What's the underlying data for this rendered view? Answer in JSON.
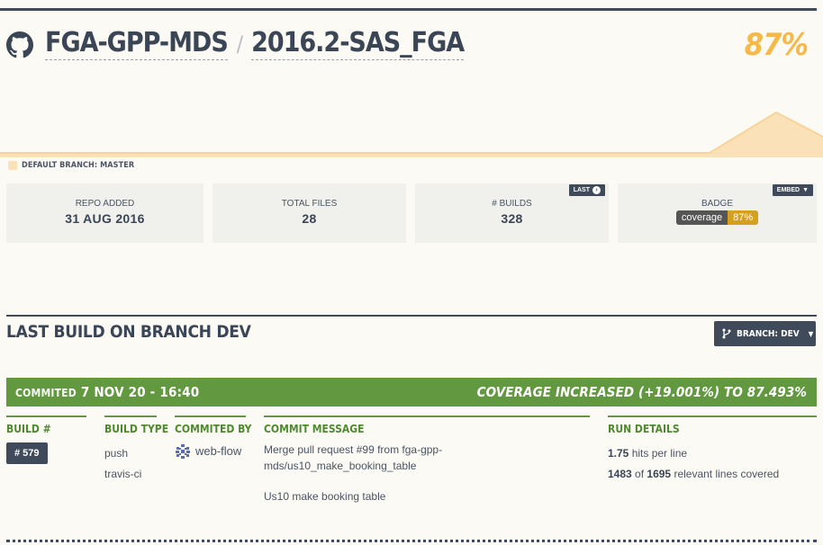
{
  "header": {
    "owner": "FGA-GPP-MDS",
    "separator": "/",
    "repo": "2016.2-SAS_FGA",
    "coverage": "87%"
  },
  "default_branch": "DEFAULT BRANCH: MASTER",
  "stats": [
    {
      "label": "REPO ADDED",
      "value": "31 AUG 2016"
    },
    {
      "label": "TOTAL FILES",
      "value": "28"
    },
    {
      "label": "# BUILDS",
      "value": "328",
      "tag": "LAST"
    },
    {
      "label": "BADGE",
      "tag": "EMBED",
      "badge_left": "coverage",
      "badge_right": "87%"
    }
  ],
  "section": {
    "title": "LAST BUILD ON BRANCH DEV",
    "branch_button": "BRANCH: DEV"
  },
  "build_bar": {
    "commited_label": "COMMITED",
    "commited_date": "7 NOV 20 - 16:40",
    "coverage_change": "COVERAGE INCREASED (+19.001%) TO 87.493%"
  },
  "columns": {
    "build": "BUILD #",
    "build_type": "BUILD TYPE",
    "commited_by": "COMMITED BY",
    "commit_message": "COMMIT MESSAGE",
    "run_details": "RUN DETAILS"
  },
  "build": {
    "number": "# 579",
    "type_1": "push",
    "type_2": "travis-ci",
    "author": "web-flow",
    "message_1": "Merge pull request #99 from fga-gpp-",
    "message_2": "mds/us10_make_booking_table",
    "message_3": "Us10 make booking table",
    "hits": "1.75",
    "hits_label": "hits per line",
    "covered": "1483",
    "of_label": "of",
    "relevant": "1695",
    "relevant_label": "relevant lines covered"
  },
  "colors": {
    "accent_dark": "#3f4b5b",
    "success_green": "#62983f",
    "coverage_orange": "#f7b84a",
    "badge_gold": "#d3a11b"
  }
}
